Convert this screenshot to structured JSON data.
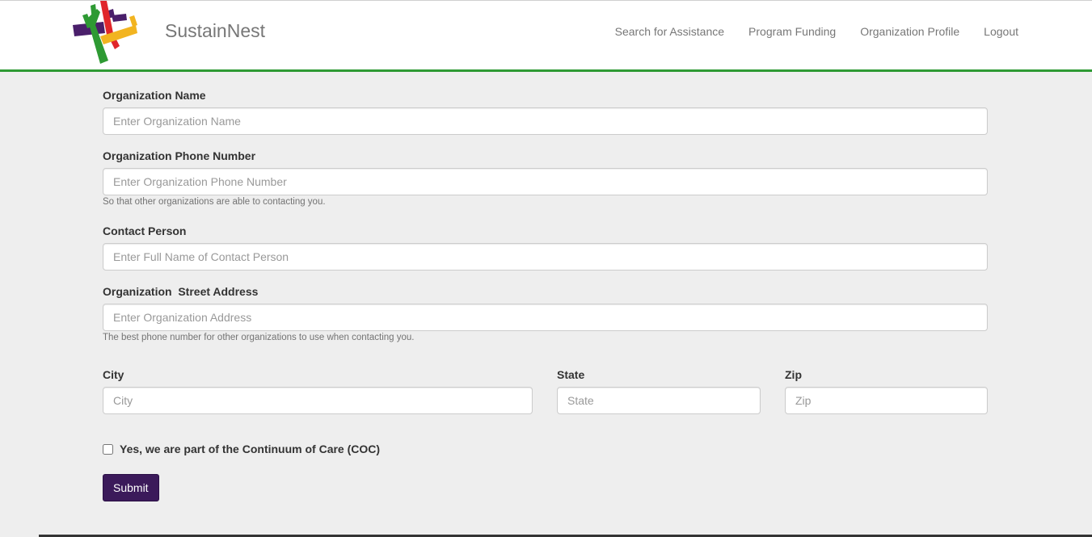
{
  "brand": {
    "name": "SustainNest"
  },
  "nav": {
    "items": [
      "Search for Assistance",
      "Program Funding",
      "Organization Profile",
      "Logout"
    ]
  },
  "form": {
    "org_name": {
      "label": "Organization Name",
      "placeholder": "Enter Organization Name"
    },
    "org_phone": {
      "label": "Organization Phone Number",
      "placeholder": "Enter Organization Phone Number",
      "help": "So that other organizations are able to contacting you."
    },
    "contact": {
      "label": "Contact Person",
      "placeholder": "Enter Full Name of Contact Person"
    },
    "address": {
      "label": "Organization  Street Address",
      "placeholder": "Enter Organization Address",
      "help": "The best phone number for other organizations to use when contacting you."
    },
    "city": {
      "label": "City",
      "placeholder": "City"
    },
    "state": {
      "label": "State",
      "placeholder": "State"
    },
    "zip": {
      "label": "Zip",
      "placeholder": "Zip"
    },
    "coc": {
      "label": "Yes, we are part of the Continuum of Care (COC)",
      "checked": false
    },
    "submit_label": "Submit"
  },
  "colors": {
    "accent_green": "#2e9a33",
    "submit_purple": "#3b1a5a"
  }
}
